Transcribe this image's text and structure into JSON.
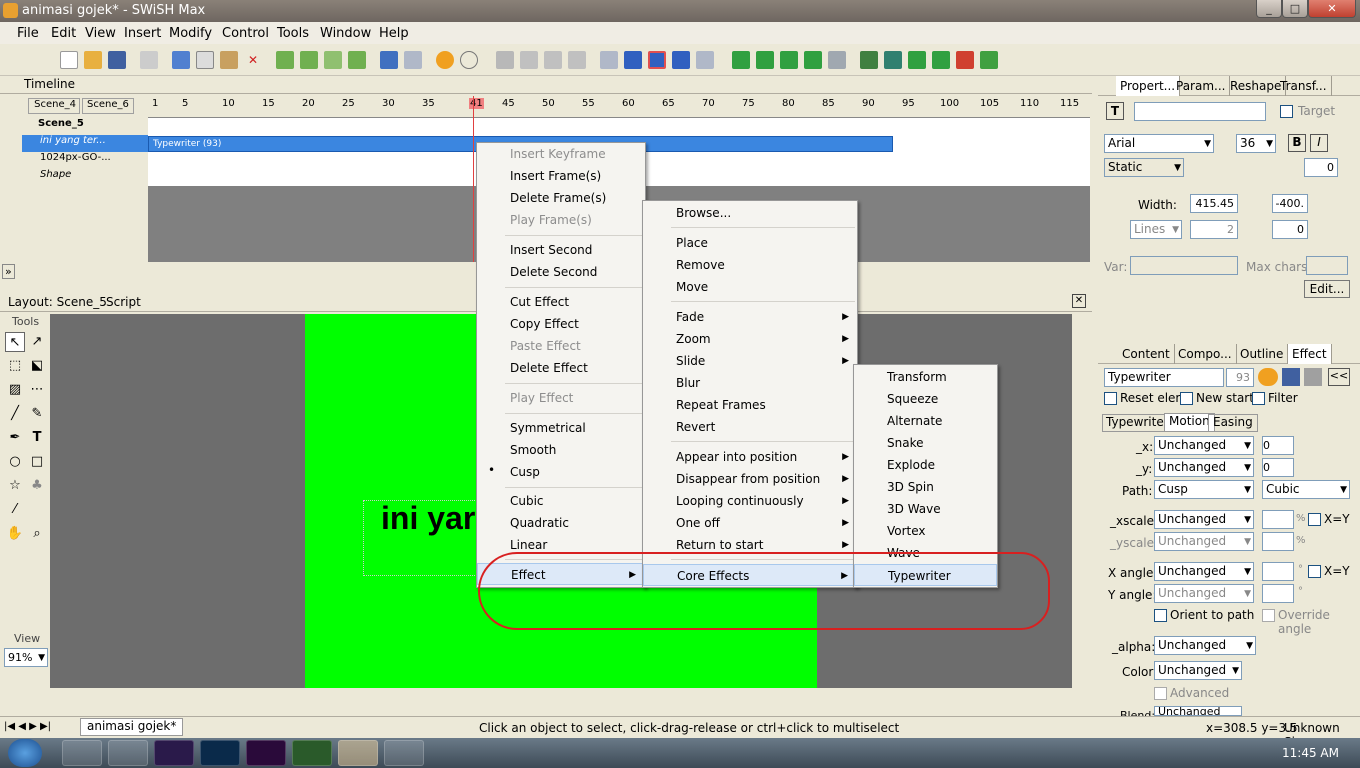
{
  "window": {
    "title": "animasi gojek* - SWiSH Max",
    "min": "_",
    "max": "□",
    "close": "✕"
  },
  "menubar": [
    "File",
    "Edit",
    "View",
    "Insert",
    "Modify",
    "Control",
    "Tools",
    "Window",
    "Help"
  ],
  "timeline": {
    "title": "Timeline",
    "scenes": [
      "Scene_4",
      "Scene_6"
    ],
    "ruler": [
      "1",
      "5",
      "10",
      "15",
      "20",
      "25",
      "30",
      "35",
      "41",
      "45",
      "50",
      "55",
      "60",
      "65",
      "70",
      "75",
      "80",
      "85",
      "90",
      "95",
      "100",
      "105",
      "110",
      "115"
    ],
    "layers": [
      {
        "name": "Scene_5"
      },
      {
        "name": "ini yang ter..."
      },
      {
        "name": "1024px-GO-..."
      },
      {
        "name": "Shape"
      }
    ],
    "effect_bar": "Typewriter (93)",
    "expand": "»"
  },
  "layout": {
    "tab_layout": "Layout: Scene_5",
    "tab_script": "Script",
    "tools_label": "Tools",
    "view_label": "View",
    "zoom": "91%",
    "stage_text": "ini yar"
  },
  "menu1": {
    "items": [
      "Insert Keyframe",
      "Insert Frame(s)",
      "Delete Frame(s)",
      "Play Frame(s)",
      "Insert Second",
      "Delete Second",
      "Cut Effect",
      "Copy Effect",
      "Paste Effect",
      "Delete Effect",
      "Play Effect",
      "Symmetrical",
      "Smooth",
      "Cusp",
      "Cubic",
      "Quadratic",
      "Linear",
      "Effect"
    ]
  },
  "menu2": {
    "items": [
      "Browse...",
      "Place",
      "Remove",
      "Move",
      "Fade",
      "Zoom",
      "Slide",
      "Blur",
      "Repeat Frames",
      "Revert",
      "Appear into position",
      "Disappear from position",
      "Looping continuously",
      "One off",
      "Return to start",
      "Core Effects"
    ]
  },
  "menu3": {
    "items": [
      "Transform",
      "Squeeze",
      "Alternate",
      "Snake",
      "Explode",
      "3D Spin",
      "3D Wave",
      "Vortex",
      "Wave",
      "Typewriter"
    ]
  },
  "properties": {
    "tabs": [
      "Propert...",
      "Param...",
      "Reshape",
      "Transf..."
    ],
    "target": "Target",
    "font": "Arial",
    "size": "36",
    "bold": "B",
    "italic": "I",
    "mode": "Static",
    "width_label": "Width:",
    "width": "415.45",
    "spacing": "-400.",
    "lines": "Lines",
    "lines_val": "2",
    "indent": "0",
    "kern": "0",
    "var_label": "Var:",
    "maxchars": "Max chars:",
    "edit": "Edit..."
  },
  "effect_panel": {
    "tabs": [
      "Content",
      "Compo...",
      "Outline",
      "Effect"
    ],
    "name": "Typewriter",
    "frames": "93",
    "reset": "Reset elem.",
    "newstart": "New start",
    "filter": "Filter",
    "subtabs": [
      "Typewriter",
      "Motion",
      "Easing"
    ],
    "rows": [
      {
        "label": "_x:",
        "val": "Unchanged",
        "num": "0"
      },
      {
        "label": "_y:",
        "val": "Unchanged",
        "num": "0"
      }
    ],
    "path_label": "Path:",
    "path": "Cusp",
    "path2": "Cubic",
    "xscale": "_xscale:",
    "yscale": "_yscale:",
    "xy": "X=Y",
    "pct": "%",
    "xangle": "X angle:",
    "yangle": "Y angle:",
    "deg": "°",
    "orient": "Orient to path",
    "override": "Override angle",
    "alpha": "_alpha:",
    "color": "Color:",
    "advanced": "Advanced",
    "blend": "Blend:",
    "unchanged": "Unchanged"
  },
  "status": {
    "doc_tab": "animasi gojek*",
    "hint": "Click an object to select, click-drag-release or ctrl+click to multiselect",
    "coords": "x=308.5 y=3.5",
    "size": "Unknown Size"
  },
  "taskbar": {
    "time": "11:45 AM"
  }
}
